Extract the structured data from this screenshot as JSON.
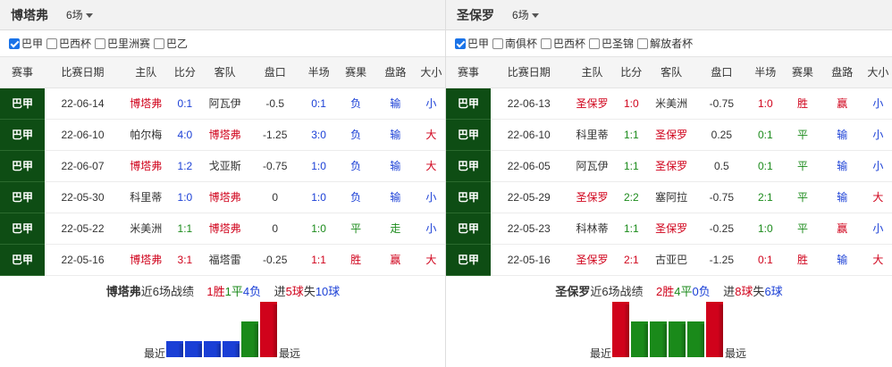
{
  "panels": [
    {
      "team": "博塔弗",
      "count": "6场",
      "filters": [
        {
          "label": "巴甲",
          "checked": true
        },
        {
          "label": "巴西杯",
          "checked": false
        },
        {
          "label": "巴里洲赛",
          "checked": false
        },
        {
          "label": "巴乙",
          "checked": false
        }
      ],
      "headers": [
        "赛事",
        "比赛日期",
        "主队",
        "比分",
        "客队",
        "盘口",
        "半场",
        "赛果",
        "盘路",
        "大小"
      ],
      "rows": [
        {
          "league": "巴甲",
          "date": "22-06-14",
          "home": "博塔弗",
          "score": "0:1",
          "away": "阿瓦伊",
          "handicap": "-0.5",
          "half": "0:1",
          "result": "负",
          "pan": "输",
          "ou": "小"
        },
        {
          "league": "巴甲",
          "date": "22-06-10",
          "home": "帕尔梅",
          "score": "4:0",
          "away": "博塔弗",
          "handicap": "-1.25",
          "half": "3:0",
          "result": "负",
          "pan": "输",
          "ou": "大"
        },
        {
          "league": "巴甲",
          "date": "22-06-07",
          "home": "博塔弗",
          "score": "1:2",
          "away": "戈亚斯",
          "handicap": "-0.75",
          "half": "1:0",
          "result": "负",
          "pan": "输",
          "ou": "大"
        },
        {
          "league": "巴甲",
          "date": "22-05-30",
          "home": "科里蒂",
          "score": "1:0",
          "away": "博塔弗",
          "handicap": "0",
          "half": "1:0",
          "result": "负",
          "pan": "输",
          "ou": "小"
        },
        {
          "league": "巴甲",
          "date": "22-05-22",
          "home": "米美洲",
          "score": "1:1",
          "away": "博塔弗",
          "handicap": "0",
          "half": "1:0",
          "result": "平",
          "pan": "走",
          "ou": "小"
        },
        {
          "league": "巴甲",
          "date": "22-05-16",
          "home": "博塔弗",
          "score": "3:1",
          "away": "福塔雷",
          "handicap": "-0.25",
          "half": "1:1",
          "result": "胜",
          "pan": "赢",
          "ou": "大"
        }
      ],
      "summary": {
        "team": "博塔弗",
        "recent": "近6场战绩",
        "win": "1胜",
        "draw": "1平",
        "loss": "4负",
        "goals_for_pre": "进",
        "goals_for": "5球",
        "goals_against_pre": "失",
        "goals_against": "10球"
      },
      "bars_from_recent": [
        "loss",
        "loss",
        "loss",
        "loss",
        "draw",
        "win"
      ],
      "near_label": "最近",
      "far_label": "最远"
    },
    {
      "team": "圣保罗",
      "count": "6场",
      "filters": [
        {
          "label": "巴甲",
          "checked": true
        },
        {
          "label": "南俱杯",
          "checked": false
        },
        {
          "label": "巴西杯",
          "checked": false
        },
        {
          "label": "巴圣锦",
          "checked": false
        },
        {
          "label": "解放者杯",
          "checked": false
        }
      ],
      "headers": [
        "赛事",
        "比赛日期",
        "主队",
        "比分",
        "客队",
        "盘口",
        "半场",
        "赛果",
        "盘路",
        "大小"
      ],
      "rows": [
        {
          "league": "巴甲",
          "date": "22-06-13",
          "home": "圣保罗",
          "score": "1:0",
          "away": "米美洲",
          "handicap": "-0.75",
          "half": "1:0",
          "result": "胜",
          "pan": "赢",
          "ou": "小"
        },
        {
          "league": "巴甲",
          "date": "22-06-10",
          "home": "科里蒂",
          "score": "1:1",
          "away": "圣保罗",
          "handicap": "0.25",
          "half": "0:1",
          "result": "平",
          "pan": "输",
          "ou": "小"
        },
        {
          "league": "巴甲",
          "date": "22-06-05",
          "home": "阿瓦伊",
          "score": "1:1",
          "away": "圣保罗",
          "handicap": "0.5",
          "half": "0:1",
          "result": "平",
          "pan": "输",
          "ou": "小"
        },
        {
          "league": "巴甲",
          "date": "22-05-29",
          "home": "圣保罗",
          "score": "2:2",
          "away": "塞阿拉",
          "handicap": "-0.75",
          "half": "2:1",
          "result": "平",
          "pan": "输",
          "ou": "大"
        },
        {
          "league": "巴甲",
          "date": "22-05-23",
          "home": "科林蒂",
          "score": "1:1",
          "away": "圣保罗",
          "handicap": "-0.25",
          "half": "1:0",
          "result": "平",
          "pan": "赢",
          "ou": "小"
        },
        {
          "league": "巴甲",
          "date": "22-05-16",
          "home": "圣保罗",
          "score": "2:1",
          "away": "古亚巴",
          "handicap": "-1.25",
          "half": "0:1",
          "result": "胜",
          "pan": "输",
          "ou": "大"
        }
      ],
      "summary": {
        "team": "圣保罗",
        "recent": "近6场战绩",
        "win": "2胜",
        "draw": "4平",
        "loss": "0负",
        "goals_for_pre": "进",
        "goals_for": "8球",
        "goals_against_pre": "失",
        "goals_against": "6球"
      },
      "bars_from_recent": [
        "win",
        "draw",
        "draw",
        "draw",
        "draw",
        "win"
      ],
      "near_label": "最近",
      "far_label": "最远"
    }
  ],
  "colors": {
    "win": "#d0021b",
    "draw": "#1a8a1a",
    "loss": "#1a3fd6",
    "league_bg": "#0e4d14"
  }
}
